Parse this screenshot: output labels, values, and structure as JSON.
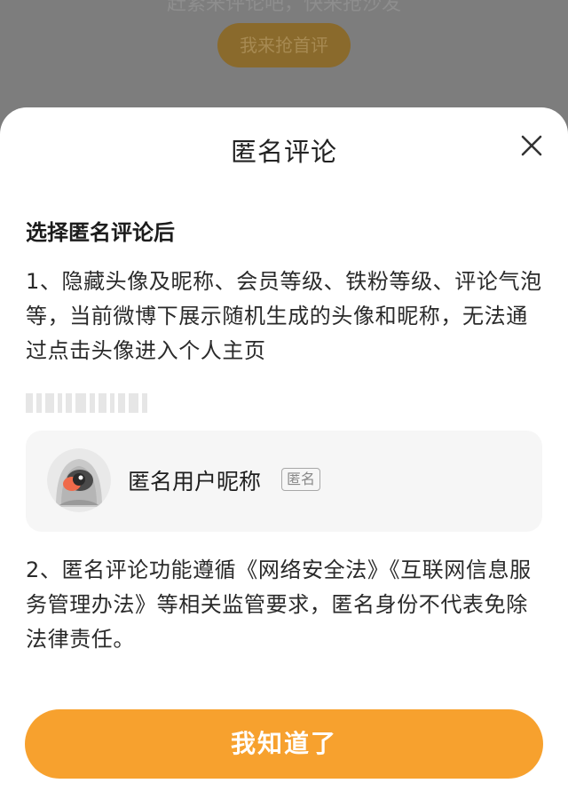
{
  "background": {
    "hint_text": "赶紧来评论吧，快来抢沙发",
    "first_comment_button": "我来抢首评"
  },
  "sheet": {
    "title": "匿名评论",
    "close_icon": "close-icon",
    "section_heading": "选择匿名评论后",
    "point_1": "1、隐藏头像及昵称、会员等级、铁粉等级、评论气泡等，当前微博下展示随机生成的头像和昵称，无法通过点击头像进入个人主页",
    "preview": {
      "avatar_icon": "anonymous-avatar-icon",
      "nickname": "匿名用户昵称",
      "tag": "匿名"
    },
    "point_2": "2、匿名评论功能遵循《网络安全法》《互联网信息服务管理办法》等相关监管要求，匿名身份不代表免除法律责任。",
    "confirm_button": "我知道了"
  },
  "colors": {
    "accent": "#f7a12e",
    "overlay": "#7d7d7d",
    "card_bg": "#f6f6f6"
  }
}
